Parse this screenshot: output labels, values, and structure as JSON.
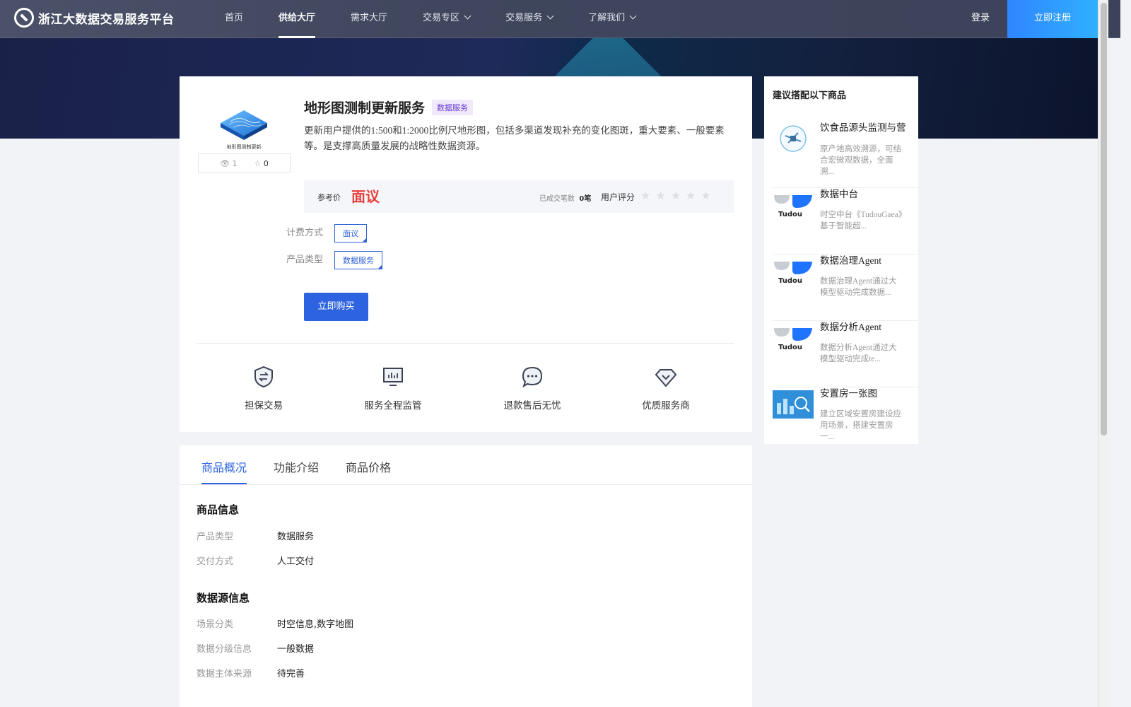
{
  "header": {
    "logo_text": "浙江大数据交易服务平台",
    "nav": [
      {
        "label": "首页",
        "dropdown": false
      },
      {
        "label": "供给大厅",
        "dropdown": false,
        "active": true
      },
      {
        "label": "需求大厅",
        "dropdown": false
      },
      {
        "label": "交易专区",
        "dropdown": true
      },
      {
        "label": "交易服务",
        "dropdown": true
      },
      {
        "label": "了解我们",
        "dropdown": true
      }
    ],
    "login": "登录",
    "register": "立即注册"
  },
  "product": {
    "thumb_caption": "地形图测制更新",
    "views": "1",
    "favorites": "0",
    "title": "地形图测制更新服务",
    "tag": "数据服务",
    "description": "更新用户提供的1:500和1:2000比例尺地形图，包括多渠道发现补充的变化图斑，重大要素、一般要素等。是支撑高质量发展的战略性数据资源。",
    "price_label": "参考价",
    "price_value": "面议",
    "deals_label": "已成交笔数",
    "deals_count": "0笔",
    "rating_label": "用户评分",
    "rating": 0,
    "billing_label": "计费方式",
    "billing_value": "面议",
    "type_label": "产品类型",
    "type_value": "数据服务",
    "buy_button": "立即购买"
  },
  "features": [
    {
      "label": "担保交易",
      "icon": "shield-exchange-icon"
    },
    {
      "label": "服务全程监管",
      "icon": "monitor-chart-icon"
    },
    {
      "label": "退款售后无忧",
      "icon": "chat-bubble-icon"
    },
    {
      "label": "优质服务商",
      "icon": "diamond-check-icon"
    }
  ],
  "tabs": [
    "商品概况",
    "功能介绍",
    "商品价格"
  ],
  "info": {
    "section1_title": "商品信息",
    "section1": [
      {
        "k": "产品类型",
        "v": "数据服务"
      },
      {
        "k": "交付方式",
        "v": "人工交付"
      }
    ],
    "section2_title": "数据源信息",
    "section2": [
      {
        "k": "场景分类",
        "v": "时空信息,数字地图"
      },
      {
        "k": "数据分级信息",
        "v": "一般数据"
      },
      {
        "k": "数据主体来源",
        "v": "待完善"
      }
    ]
  },
  "sidebar": {
    "title": "建议搭配以下商品",
    "items": [
      {
        "name": "饮食品源头监测与营",
        "desc": "原产地高效溯源，可结合宏微观数据，全面溯..."
      },
      {
        "name": "数据中台",
        "desc": "时空中台《TudouGaea》基于智能超..."
      },
      {
        "name": "数据治理Agent",
        "desc": "数据治理Agent通过大模型驱动完成数据..."
      },
      {
        "name": "数据分析Agent",
        "desc": "数据分析Agent通过大模型驱动完成te..."
      },
      {
        "name": "安置房一张图",
        "desc": "建立区域安置房建设应用场景，搭建安置房一..."
      }
    ],
    "tudou_text": "Tudou"
  }
}
